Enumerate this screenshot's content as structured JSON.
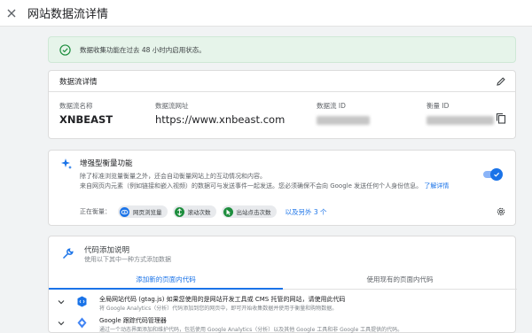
{
  "header": {
    "title": "网站数据流详情"
  },
  "banner": {
    "text": "数据收集功能在过去 48 小时内启用状态。"
  },
  "stream_details": {
    "heading": "数据流详情",
    "fields": [
      {
        "label": "数据流名称",
        "value": "XNBEAST"
      },
      {
        "label": "数据流网址",
        "value": "https://www.xnbeast.com"
      },
      {
        "label": "数据流 ID",
        "value": ""
      },
      {
        "label": "衡量 ID",
        "value": ""
      }
    ]
  },
  "enhanced": {
    "title": "增强型衡量功能",
    "desc_line1": "除了标准浏览量衡量之外，还会自动衡量网站上的互动情况和内容。",
    "desc_line2": "来自网页内元素（例如链接和嵌入视频）的数据可与发送事件一起发送。您必须确保不会向 Google 发送任何个人身份信息。",
    "learn_more": "了解详情",
    "measuring_label": "正在衡量：",
    "chips": [
      "网页浏览量",
      "滚动次数",
      "出站点击次数"
    ],
    "more": "以及另外 3 个",
    "toggle_on": true
  },
  "tagging": {
    "title": "代码添加说明",
    "subtitle": "使用以下其中一种方式添加数据",
    "tabs": [
      "添加新的页面内代码",
      "使用现有的页面内代码"
    ],
    "options": [
      {
        "title": "全局网站代码 (gtag.js) 如果您使用的是网站开发工具或 CMS 托管的网站，请使用此代码",
        "desc": "将 Google Analytics（分析）代码添加到您的网页中，即可开始收集数据并使用于衡量和购物数据。"
      },
      {
        "title": "Google 跟踪代码管理器",
        "desc": "通过一个动态界面添加和维护代码，包括使用 Google Analytics（分析）以及其他 Google 工具和非 Google 工具提供的代码。"
      }
    ]
  },
  "colors": {
    "accent": "#1a73e8",
    "success": "#1e8e3e",
    "banner_bg": "#e6f4ea"
  }
}
